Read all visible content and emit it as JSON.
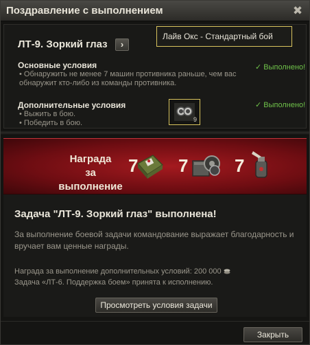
{
  "window": {
    "title": "Поздравление с выполнением",
    "close_glyph": "✖"
  },
  "quest": {
    "name": "ЛТ-9. Зоркий глаз",
    "arrow_glyph": "›",
    "battle_type": "Лайв Окс - Стандартный бой",
    "main_conditions": {
      "title": "Основные условия",
      "text": "• Обнаружить не менее 7 машин противника раньше, чем вас обнаружит кто-либо из команды противника.",
      "status": "✓ Выполнено!"
    },
    "extra_conditions": {
      "title": "Дополнительные условия",
      "lines": [
        "• Выжить в бою.",
        "• Победить в бою."
      ],
      "status": "✓ Выполнено!",
      "badge_count": "9"
    }
  },
  "reward": {
    "label_line1": "Награда",
    "label_line2": "за выполнение",
    "items": [
      {
        "count": "7",
        "icon": "first-aid-kit-icon"
      },
      {
        "count": "7",
        "icon": "repair-kit-icon"
      },
      {
        "count": "7",
        "icon": "fire-extinguisher-icon"
      }
    ],
    "colors": {
      "banner": "#8e1218"
    }
  },
  "completion": {
    "title": "Задача \"ЛТ-9. Зоркий глаз\" выполнена!",
    "text": "За выполнение боевой задачи командование выражает благодарность и вручает вам ценные награды.",
    "extra_reward": "Награда за выполнение дополнительных условий: 200 000",
    "next_task": "Задача «ЛТ-6. Поддержка боем» принята к исполнению.",
    "view_button": "Просмотреть условия задачи"
  },
  "footer": {
    "close_button": "Закрыть"
  },
  "colors": {
    "done": "#6fc24a",
    "highlight_border": "#d9c45e"
  }
}
